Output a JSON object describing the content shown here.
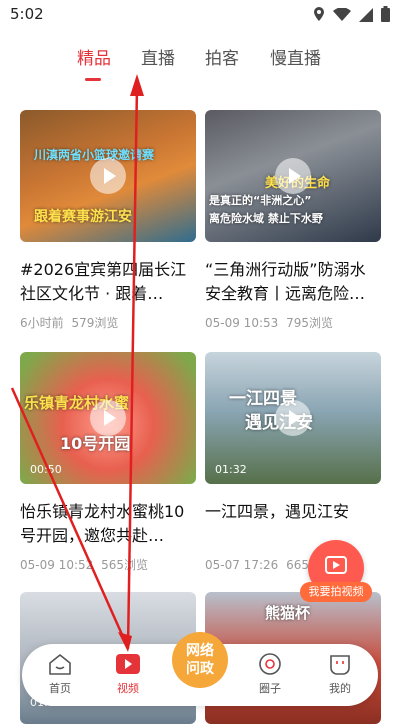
{
  "status": {
    "time": "5:02"
  },
  "tabs": [
    {
      "label": "精品",
      "active": true
    },
    {
      "label": "直播",
      "active": false
    },
    {
      "label": "拍客",
      "active": false
    },
    {
      "label": "慢直播",
      "active": false
    }
  ],
  "cards": [
    {
      "title": "#2026宜宾第四届长江社区文化节 · 跟着…",
      "time": "6小时前",
      "views": "579浏览",
      "thumb_text": [
        "川滇两省小篮球邀请赛",
        "跟着赛事游江安"
      ],
      "duration": ""
    },
    {
      "title": "“三角洲行动版”防溺水安全教育丨远离危险…",
      "time": "05-09 10:53",
      "views": "795浏览",
      "thumb_text": [
        "美好的生命",
        "是真正的“非洲之心”",
        "离危险水域 禁止下水野"
      ],
      "duration": ""
    },
    {
      "title": "怡乐镇青龙村水蜜桃10号开园，邀您共赴…",
      "time": "05-09 10:52",
      "views": "565浏览",
      "thumb_text": [
        "乐镇青龙村水蜜",
        "10号开园"
      ],
      "duration": "00:50"
    },
    {
      "title": "一江四景，遇见江安",
      "time": "05-07 17:26",
      "views": "665浏览",
      "thumb_text": [
        "一江四景",
        "遇见江安"
      ],
      "duration": "01:32"
    },
    {
      "title": "",
      "time": "",
      "views": "",
      "thumb_text": [],
      "duration": "01:07"
    },
    {
      "title": "",
      "time": "",
      "views": "",
      "thumb_text": [
        "熊猫杯"
      ],
      "duration": ""
    }
  ],
  "fab": {
    "label": "我要拍视频"
  },
  "nav": {
    "home": "首页",
    "video": "视频",
    "center": "网络问政",
    "circle": "圈子",
    "mine": "我的"
  },
  "colors": {
    "accent": "#e5333a",
    "center_button": "#f6a73a",
    "fab": "#ff5a4f"
  }
}
